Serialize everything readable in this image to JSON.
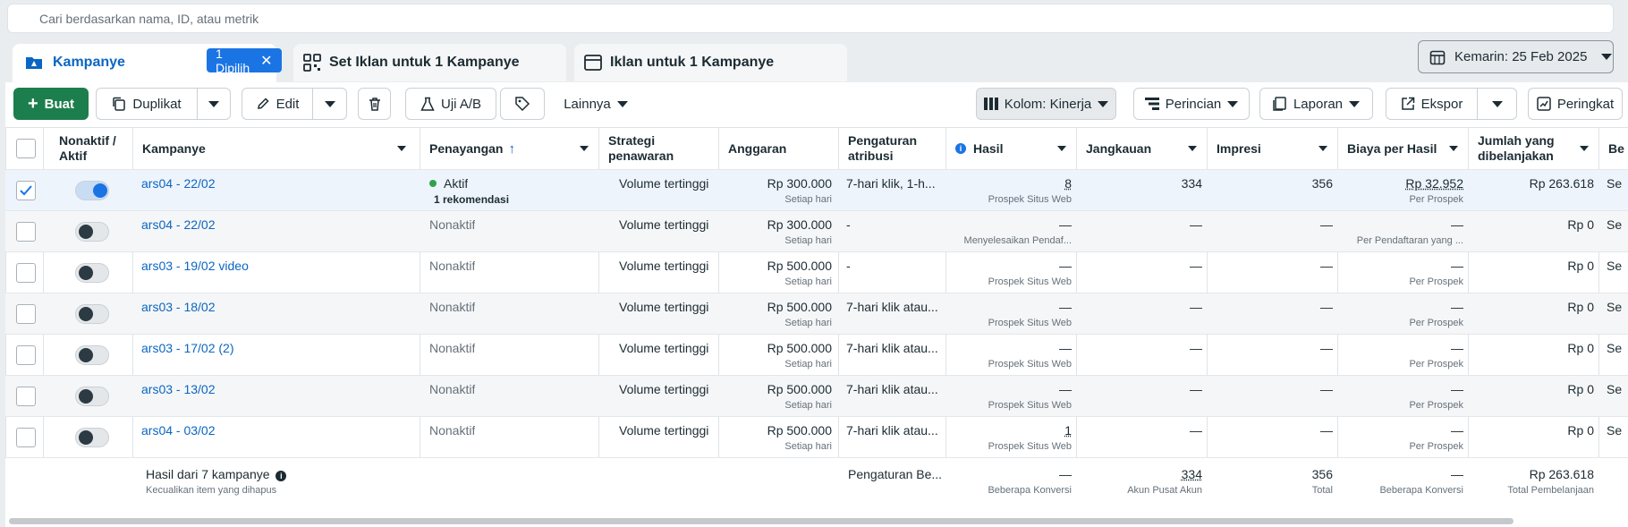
{
  "search": {
    "placeholder": "Cari berdasarkan nama, ID, atau metrik"
  },
  "tabs": [
    {
      "label": "Kampanye",
      "selected_badge": "1 Dipilih"
    },
    {
      "label": "Set Iklan untuk 1 Kampanye"
    },
    {
      "label": "Iklan untuk 1 Kampanye"
    }
  ],
  "date_range": "Kemarin: 25 Feb 2025",
  "toolbar": {
    "create": "Buat",
    "duplicate": "Duplikat",
    "edit": "Edit",
    "ab_test": "Uji A/B",
    "more": "Lainnya",
    "columns": "Kolom: Kinerja",
    "breakdown": "Perincian",
    "reports": "Laporan",
    "export": "Ekspor",
    "ranking": "Peringkat"
  },
  "columns": {
    "toggle": "Nonaktif / Aktif",
    "campaign": "Kampanye",
    "delivery": "Penayangan",
    "bid": "Strategi penawaran",
    "budget": "Anggaran",
    "attribution": "Pengaturan atribusi",
    "results": "Hasil",
    "reach": "Jangkauan",
    "impressions": "Impresi",
    "cpr": "Biaya per Hasil",
    "spent": "Jumlah yang dibelanjakan",
    "next": "Be"
  },
  "rows": [
    {
      "selected": true,
      "on": true,
      "name": "ars04 - 22/02",
      "delivery": "Aktif",
      "delivery_sub": "1 rekomendasi",
      "bid": "Volume tertinggi",
      "budget": "Rp 300.000",
      "budget_sub": "Setiap hari",
      "attribution": "7-hari klik, 1-h...",
      "results": "8",
      "results_sub": "Prospek Situs Web",
      "reach": "334",
      "impressions": "356",
      "cpr": "Rp 32.952",
      "cpr_sub": "Per Prospek",
      "spent": "Rp 263.618",
      "next": "Se"
    },
    {
      "selected": false,
      "on": false,
      "name": "ars04 - 22/02",
      "delivery": "Nonaktif",
      "delivery_sub": "",
      "bid": "Volume tertinggi",
      "budget": "Rp 300.000",
      "budget_sub": "Setiap hari",
      "attribution": "-",
      "results": "—",
      "results_sub": "Menyelesaikan Pendaf...",
      "reach": "—",
      "impressions": "—",
      "cpr": "—",
      "cpr_sub": "Per Pendaftaran yang ...",
      "spent": "Rp 0",
      "next": "Se"
    },
    {
      "selected": false,
      "on": false,
      "name": "ars03 - 19/02 video",
      "delivery": "Nonaktif",
      "delivery_sub": "",
      "bid": "Volume tertinggi",
      "budget": "Rp 500.000",
      "budget_sub": "Setiap hari",
      "attribution": "-",
      "results": "—",
      "results_sub": "Prospek Situs Web",
      "reach": "—",
      "impressions": "—",
      "cpr": "—",
      "cpr_sub": "Per Prospek",
      "spent": "Rp 0",
      "next": "Se"
    },
    {
      "selected": false,
      "on": false,
      "name": "ars03 - 18/02",
      "delivery": "Nonaktif",
      "delivery_sub": "",
      "bid": "Volume tertinggi",
      "budget": "Rp 500.000",
      "budget_sub": "Setiap hari",
      "attribution": "7-hari klik atau...",
      "results": "—",
      "results_sub": "Prospek Situs Web",
      "reach": "—",
      "impressions": "—",
      "cpr": "—",
      "cpr_sub": "Per Prospek",
      "spent": "Rp 0",
      "next": "Se"
    },
    {
      "selected": false,
      "on": false,
      "name": "ars03 - 17/02 (2)",
      "delivery": "Nonaktif",
      "delivery_sub": "",
      "bid": "Volume tertinggi",
      "budget": "Rp 500.000",
      "budget_sub": "Setiap hari",
      "attribution": "7-hari klik atau...",
      "results": "—",
      "results_sub": "Prospek Situs Web",
      "reach": "—",
      "impressions": "—",
      "cpr": "—",
      "cpr_sub": "Per Prospek",
      "spent": "Rp 0",
      "next": "Se"
    },
    {
      "selected": false,
      "on": false,
      "name": "ars03 - 13/02",
      "delivery": "Nonaktif",
      "delivery_sub": "",
      "bid": "Volume tertinggi",
      "budget": "Rp 500.000",
      "budget_sub": "Setiap hari",
      "attribution": "7-hari klik atau...",
      "results": "—",
      "results_sub": "Prospek Situs Web",
      "reach": "—",
      "impressions": "—",
      "cpr": "—",
      "cpr_sub": "Per Prospek",
      "spent": "Rp 0",
      "next": "Se"
    },
    {
      "selected": false,
      "on": false,
      "name": "ars04 - 03/02",
      "delivery": "Nonaktif",
      "delivery_sub": "",
      "bid": "Volume tertinggi",
      "budget": "Rp 500.000",
      "budget_sub": "Setiap hari",
      "attribution": "7-hari klik atau...",
      "results": "1",
      "results_sub": "Prospek Situs Web",
      "reach": "—",
      "impressions": "—",
      "cpr": "—",
      "cpr_sub": "Per Prospek",
      "spent": "Rp 0",
      "next": "Se"
    }
  ],
  "summary": {
    "title": "Hasil dari 7 kampanye",
    "subtitle": "Kecualikan item yang dihapus",
    "attribution": "Pengaturan Be...",
    "results": "—",
    "results_sub": "Beberapa Konversi",
    "reach": "334",
    "reach_sub": "Akun Pusat Akun",
    "impressions": "356",
    "impressions_sub": "Total",
    "cpr": "—",
    "cpr_sub": "Beberapa Konversi",
    "spent": "Rp 263.618",
    "spent_sub": "Total Pembelanjaan"
  },
  "colors": {
    "accent": "#0a66c2",
    "create": "#1d7e4d",
    "active_dot": "#31a24c"
  }
}
